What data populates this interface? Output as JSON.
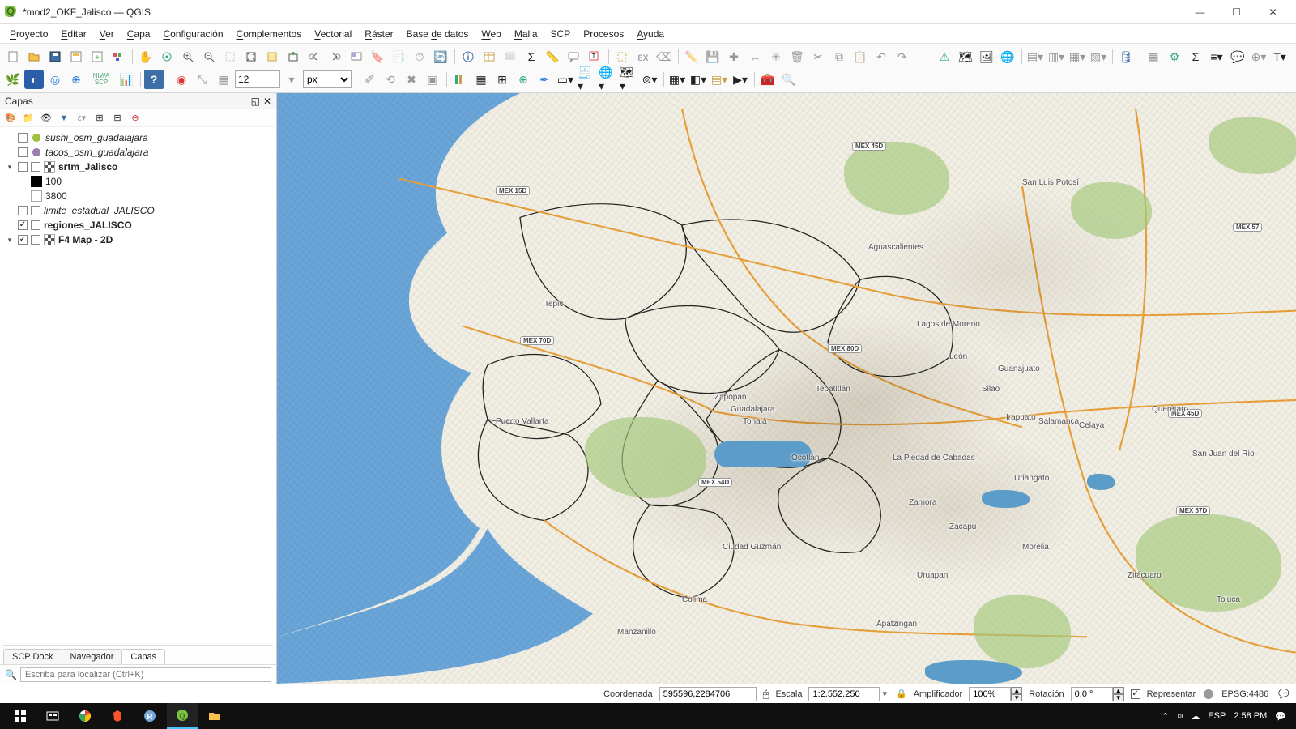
{
  "window": {
    "title": "*mod2_OKF_Jalisco — QGIS"
  },
  "menu": {
    "items": [
      "Proyecto",
      "Editar",
      "Ver",
      "Capa",
      "Configuración",
      "Complementos",
      "Vectorial",
      "Ráster",
      "Base de datos",
      "Web",
      "Malla",
      "SCP",
      "Procesos",
      "Ayuda"
    ],
    "underline_chars": [
      "P",
      "E",
      "V",
      "C",
      "C",
      "C",
      "V",
      "R",
      "d",
      "W",
      "M",
      "",
      "",
      "A"
    ]
  },
  "toolbars": {
    "row2_spin_value": "12",
    "row2_select_value": "px",
    "scp_label": "NIWA\nSCP"
  },
  "layers_panel": {
    "title": "Capas",
    "tabs": [
      "SCP Dock",
      "Navegador",
      "Capas"
    ],
    "active_tab": 2,
    "tree": [
      {
        "type": "layer",
        "expander": "none",
        "checked": false,
        "symbol": "circle-green",
        "label": "sushi_osm_guadalajara",
        "italic": true
      },
      {
        "type": "layer",
        "expander": "none",
        "checked": false,
        "symbol": "circle-purple",
        "label": "tacos_osm_guadalajara",
        "italic": true
      },
      {
        "type": "group-layer",
        "expander": "open",
        "checked": false,
        "checked2": false,
        "symbol": "checker",
        "label": "srtm_Jalisco",
        "bold": true,
        "children": [
          {
            "symbol": "black",
            "label": "100"
          },
          {
            "symbol": "white",
            "label": "3800"
          }
        ]
      },
      {
        "type": "layer",
        "expander": "none",
        "checked": false,
        "checked2": false,
        "symbol": "",
        "label": "limite_estadual_JALISCO",
        "italic": true
      },
      {
        "type": "layer",
        "expander": "none",
        "checked": true,
        "checked2": false,
        "symbol": "",
        "label": "regiones_JALISCO",
        "bold": true
      },
      {
        "type": "layer",
        "expander": "open",
        "checked": true,
        "checked2": false,
        "symbol": "checker",
        "label": "F4 Map - 2D",
        "bold": true
      }
    ]
  },
  "locator": {
    "placeholder": "Escriba para localizar (Ctrl+K)"
  },
  "map": {
    "shields": [
      "MEX 15D",
      "MEX 45D",
      "MEX 70D",
      "MEX 80D",
      "MEX 54D",
      "MEX 57",
      "MEX 57D",
      "MEX 45D"
    ],
    "cities": [
      "San Luis Potosí",
      "Aguascalientes",
      "Tepic",
      "Puerto Vallarta",
      "Zapopan",
      "Guadalajara",
      "Tonalá",
      "Tepatitlán",
      "Lagos de Moreno",
      "León",
      "Guanajuato",
      "Silao",
      "Irapuato",
      "Salamanca",
      "Celaya",
      "Querétaro",
      "San Juan del Río",
      "La Piedad de Cabadas",
      "Ocotlán",
      "Ciudad Guzmán",
      "Colima",
      "Manzanillo",
      "Zamora",
      "Zacapu",
      "Morelia",
      "Uruapan",
      "Uriangato",
      "Apatzingán",
      "Zitácuaro",
      "Toluca"
    ]
  },
  "statusbar": {
    "coord_label": "Coordenada",
    "coord_value": "595596,2284706",
    "scale_label": "Escala",
    "scale_value": "1:2.552.250",
    "magnifier_label": "Amplificador",
    "magnifier_value": "100%",
    "rotation_label": "Rotación",
    "rotation_value": "0,0 °",
    "render_label": "Representar",
    "render_checked": true,
    "crs_label": "EPSG:4486"
  },
  "taskbar": {
    "lang": "ESP",
    "time": "2:58 PM"
  }
}
